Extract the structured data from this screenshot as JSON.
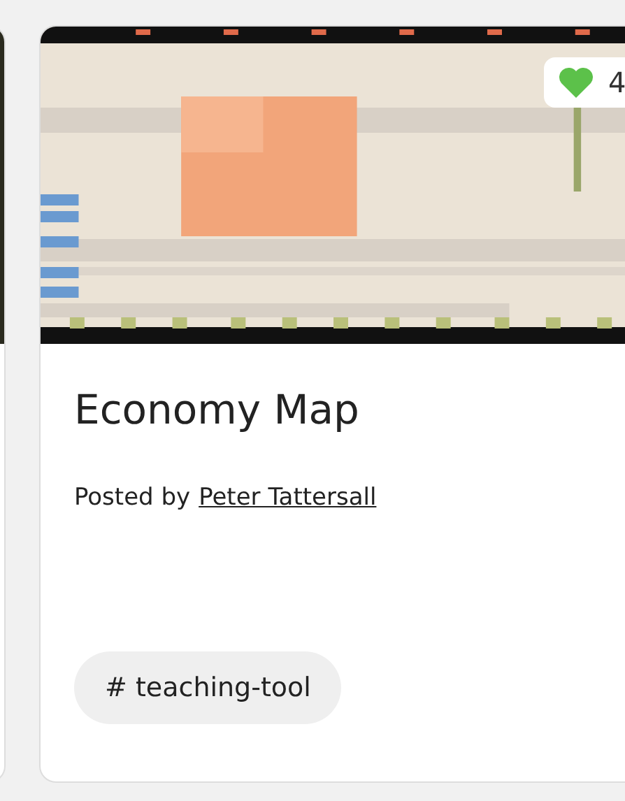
{
  "card": {
    "title": "Economy Map",
    "posted_by_label": "Posted by",
    "author": "Peter Tattersall",
    "likes": {
      "count": "4",
      "liked": true
    },
    "tags": [
      "# teaching-tool"
    ]
  }
}
